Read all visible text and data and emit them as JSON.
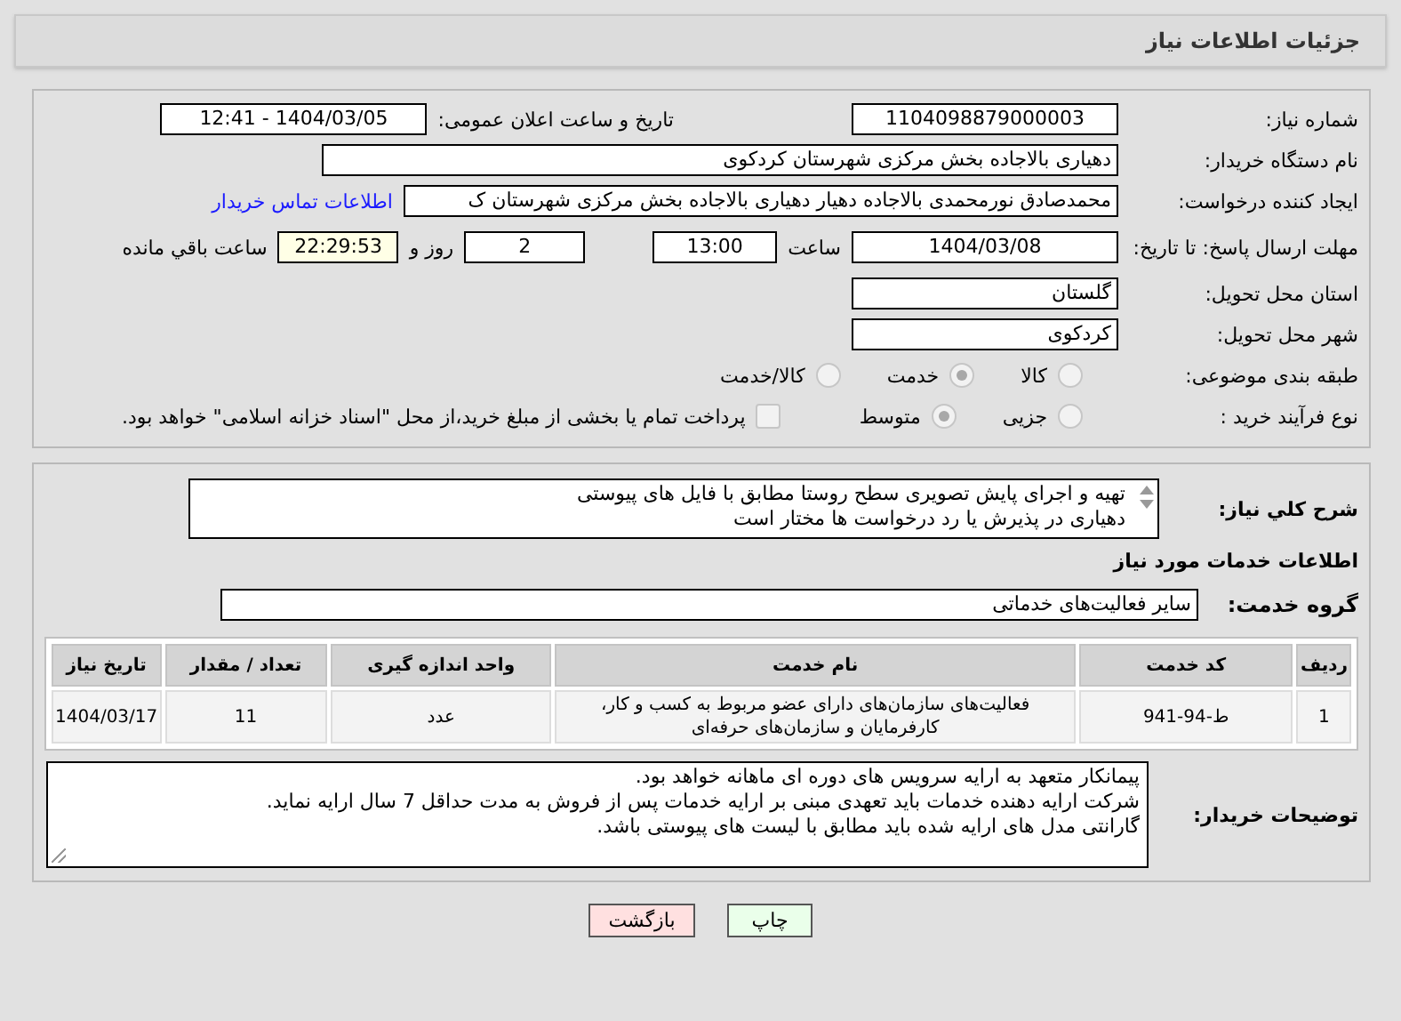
{
  "title": "جزئیات اطلاعات نیاز",
  "need_number": {
    "label": "شماره نیاز:",
    "value": "1104098879000003"
  },
  "announce": {
    "label": "تاریخ و ساعت اعلان عمومی:",
    "value": "1404/03/05 - 12:41"
  },
  "buyer": {
    "label": "نام دستگاه خریدار:",
    "value": "دهیاری بالاجاده بخش مرکزی شهرستان کردکوی"
  },
  "creator": {
    "label": "ایجاد کننده درخواست:",
    "value": "محمدصادق نورمحمدی بالاجاده دهیار دهیاری بالاجاده بخش مرکزی شهرستان ک",
    "link": "اطلاعات تماس خریدار"
  },
  "deadline": {
    "label": "مهلت ارسال پاسخ: تا تاریخ:",
    "date": "1404/03/08",
    "time_label": "ساعت",
    "time": "13:00",
    "days": "2",
    "days_label": "روز و",
    "remaining": "22:29:53",
    "remaining_label": "ساعت باقي مانده"
  },
  "province": {
    "label": "استان محل تحویل:",
    "value": "گلستان"
  },
  "city": {
    "label": "شهر محل تحویل:",
    "value": "کردکوی"
  },
  "category": {
    "label": "طبقه بندی موضوعی:",
    "options": [
      {
        "label": "کالا",
        "selected": false
      },
      {
        "label": "خدمت",
        "selected": true
      },
      {
        "label": "کالا/خدمت",
        "selected": false
      }
    ]
  },
  "purchase_type": {
    "label": "نوع فرآیند خرید :",
    "options": [
      {
        "label": "جزیی",
        "selected": false
      },
      {
        "label": "متوسط",
        "selected": true
      }
    ],
    "payment": {
      "checked": false,
      "label": "پرداخت تمام یا بخشی از مبلغ خرید،از محل \"اسناد خزانه اسلامی\" خواهد بود."
    }
  },
  "summary": {
    "label": "شرح كلي نياز:",
    "lines": [
      "تهیه و اجرای پایش تصویری سطح روستا مطابق با فایل های پیوستی",
      "دهیاری در پذیرش یا رد درخواست ها مختار است"
    ]
  },
  "services_heading": "اطلاعات خدمات مورد نیاز",
  "service_group": {
    "label": "گروه خدمت:",
    "value": "سایر فعالیت‌های خدماتی"
  },
  "table": {
    "columns": [
      "ردیف",
      "کد خدمت",
      "نام خدمت",
      "واحد اندازه گیری",
      "تعداد / مقدار",
      "تاریخ نیاز"
    ],
    "rows": [
      [
        "1",
        "ط-94-941",
        "فعالیت‌های سازمان‌های دارای عضو مربوط به کسب و کار، کارفرمایان و سازمان‌های حرفه‌ای",
        "عدد",
        "11",
        "1404/03/17"
      ]
    ]
  },
  "buyer_notes": {
    "label": "توضیحات خریدار:",
    "lines": [
      "پیمانکار متعهد به ارایه سرویس های دوره ای ماهانه خواهد بود.",
      "شرکت ارایه دهنده خدمات باید تعهدی مبنی بر ارایه خدمات پس از فروش به مدت حداقل 7 سال ارایه نماید.",
      "گارانتی مدل های ارایه شده باید مطابق با لیست های پیوستی باشد."
    ]
  },
  "buttons": [
    {
      "label": "چاپ",
      "kind": "print"
    },
    {
      "label": "بازگشت",
      "kind": "back"
    }
  ]
}
